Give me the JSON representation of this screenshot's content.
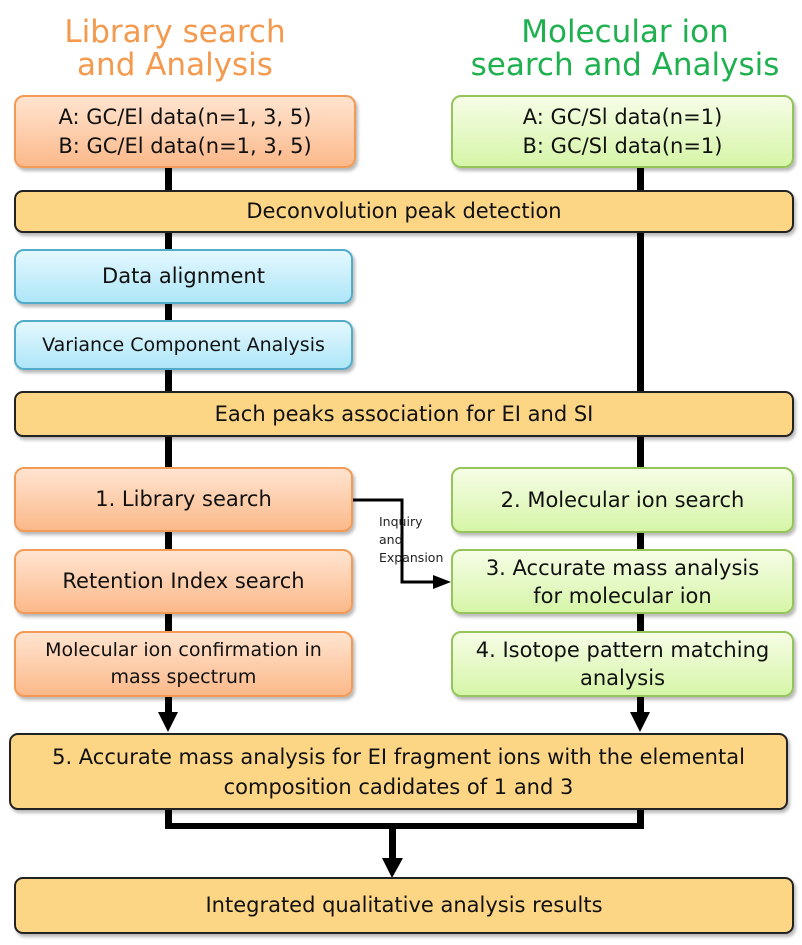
{
  "headings": {
    "left": [
      "Library search",
      "and Analysis"
    ],
    "right": [
      "Molecular ion",
      "search and Analysis"
    ]
  },
  "colors": {
    "left_heading": "#f39a4e",
    "right_heading": "#1fb050",
    "bar_fill": "#fcd585",
    "orange_border": "#f29a56",
    "green_border": "#95c45a",
    "blue_border": "#52abc8"
  },
  "boxes": {
    "ei_data": [
      "A: GC/El data(n=1, 3, 5)",
      "B: GC/El data(n=1, 3, 5)"
    ],
    "si_data": [
      "A: GC/Sl data(n=1)",
      "B: GC/Sl data(n=1)"
    ],
    "deconvolution": "Deconvolution peak detection",
    "data_alignment": "Data alignment",
    "variance": "Variance Component Analysis",
    "peaks_association": "Each peaks association for EI and SI",
    "library_search": "1. Library search",
    "molecular_ion_search": "2. Molecular ion search",
    "retention_index": "Retention Index search",
    "accurate_mass_molecular": [
      "3. Accurate mass analysis",
      "for molecular ion"
    ],
    "molecular_confirmation": [
      "Molecular ion confirmation in",
      "mass spectrum"
    ],
    "isotope_pattern": [
      "4. Isotope pattern matching",
      "analysis"
    ],
    "fragment_analysis": [
      "5. Accurate mass analysis for EI fragment ions with the elemental",
      "composition cadidates of 1 and 3"
    ],
    "integrated_results": "Integrated qualitative analysis results"
  },
  "annotation": [
    "Inquiry",
    "and",
    "Expansion"
  ]
}
